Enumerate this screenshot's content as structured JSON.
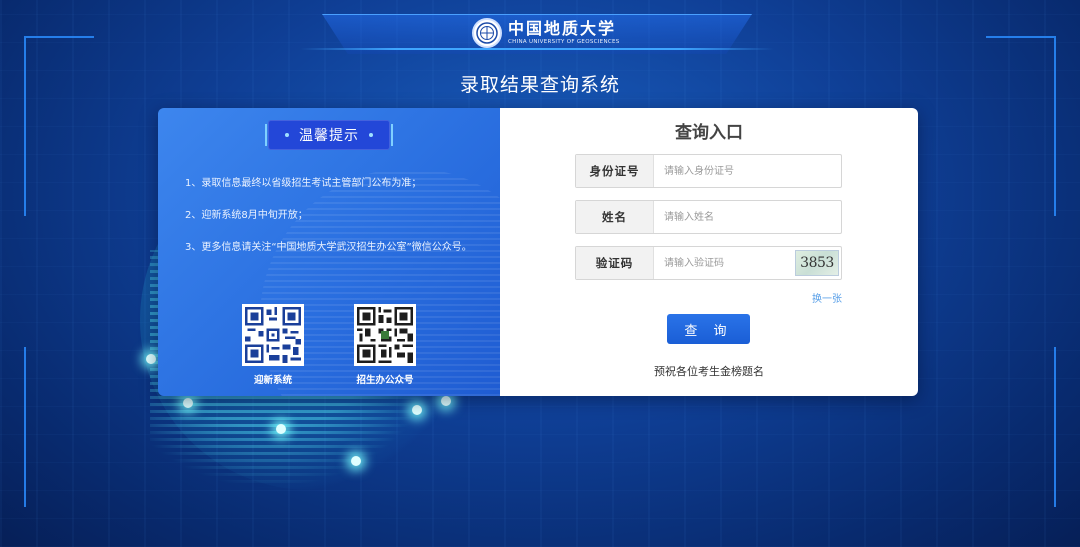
{
  "header": {
    "logo_cn": "中国地质大学",
    "logo_en": "CHINA UNIVERSITY OF GEOSCIENCES",
    "system_title": "录取结果查询系统"
  },
  "tips": {
    "title": "温馨提示",
    "items": [
      "1、录取信息最终以省级招生考试主管部门公布为准；",
      "2、迎新系统8月中旬开放；",
      "3、更多信息请关注“中国地质大学武汉招生办公室”微信公众号。"
    ],
    "qr_codes": [
      {
        "label": "迎新系统",
        "icon": "qr-code-icon"
      },
      {
        "label": "招生办公众号",
        "icon": "qr-code-icon"
      }
    ]
  },
  "query": {
    "title": "查询入口",
    "fields": [
      {
        "label": "身份证号",
        "placeholder": "请输入身份证号",
        "value": ""
      },
      {
        "label": "姓名",
        "placeholder": "请输入姓名",
        "value": ""
      },
      {
        "label": "验证码",
        "placeholder": "请输入验证码",
        "value": ""
      }
    ],
    "captcha_text": "3853",
    "refresh_label": "换一张",
    "submit_label": "查 询",
    "wish": "预祝各位考生金榜题名"
  },
  "colors": {
    "background": "#0f3f96",
    "tip_panel": "#2a6fe0",
    "badge": "#2347d8",
    "button": "#1a5ed6",
    "link": "#5aa0e8",
    "globe_glow": "#7ff6ff"
  }
}
